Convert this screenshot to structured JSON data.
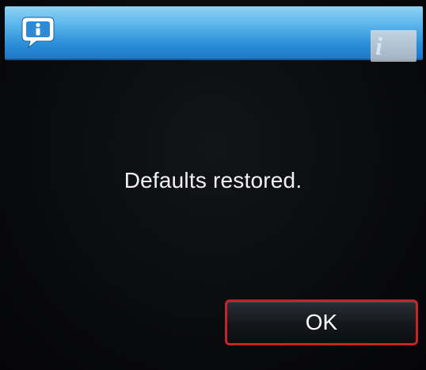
{
  "dialog": {
    "message": "Defaults restored.",
    "ok_label": "OK",
    "title_icon": "info-speech-bubble-icon",
    "help_icon": "info-i-icon",
    "help_glyph": "i"
  },
  "colors": {
    "titlebar_top": "#8fd3f5",
    "titlebar_bottom": "#1e74c4",
    "background": "#08090b",
    "button_highlight": "#c8232c",
    "text": "#f2f2f2"
  }
}
